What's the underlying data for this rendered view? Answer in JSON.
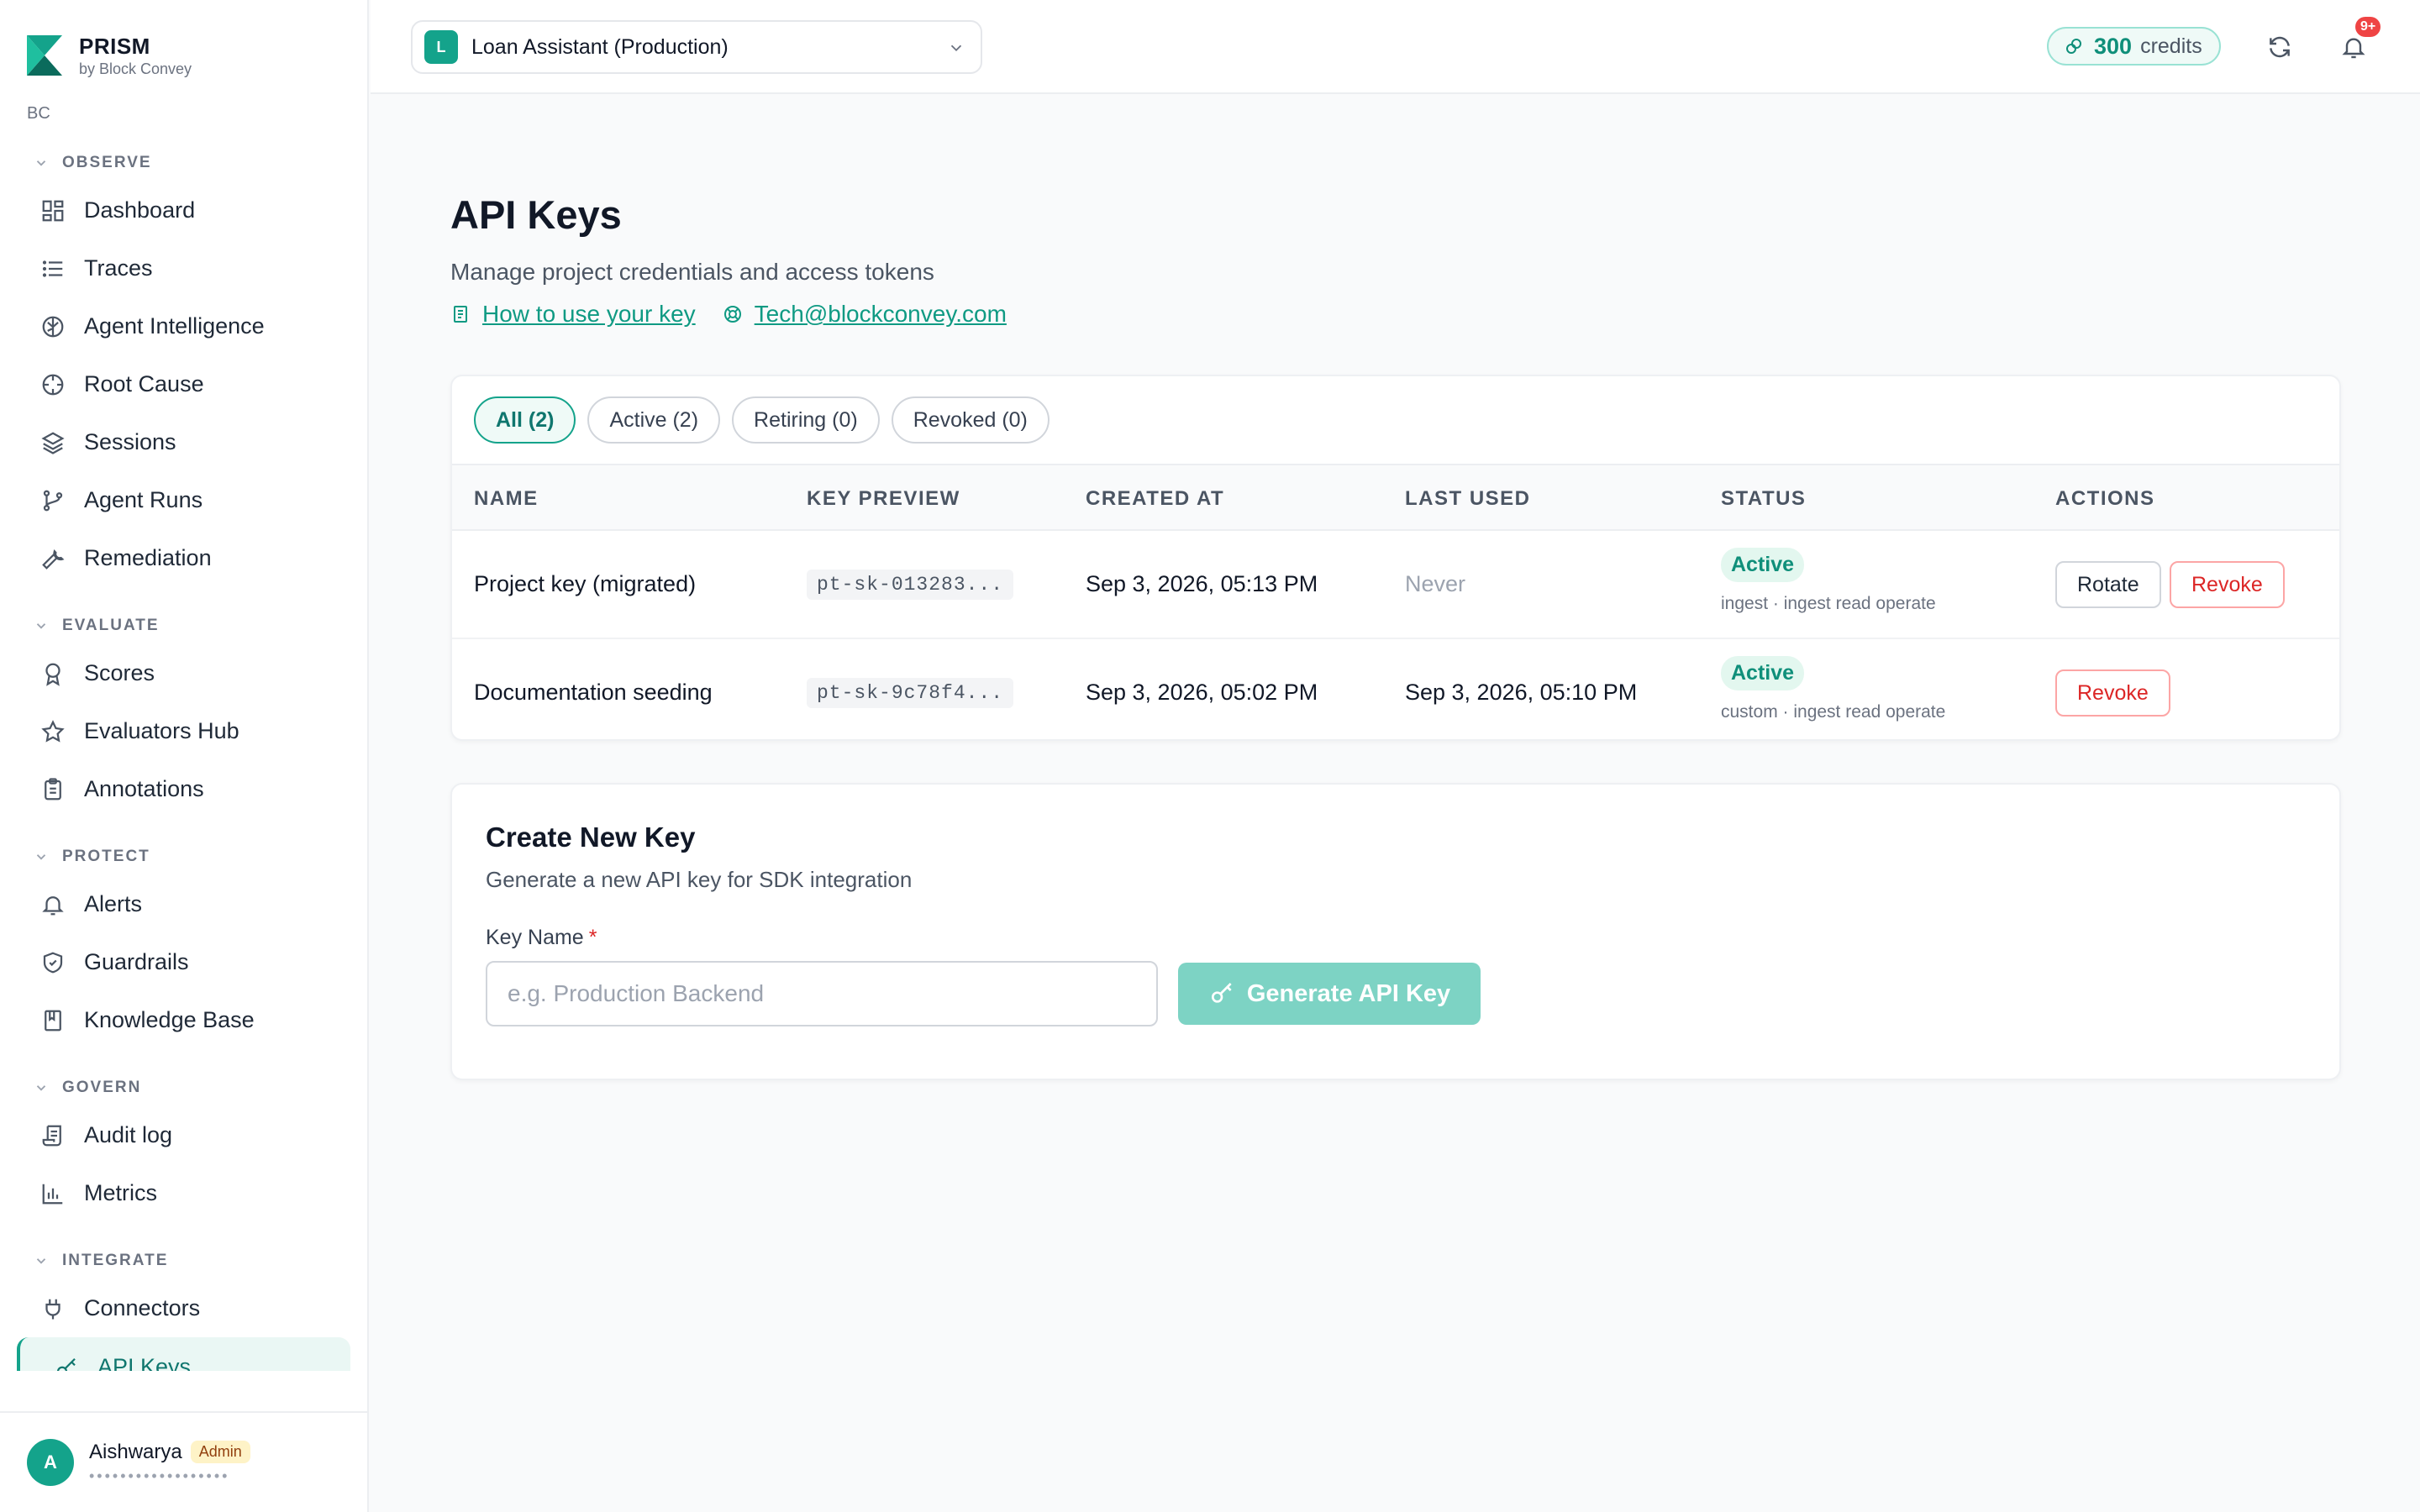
{
  "brand": {
    "name": "PRISM",
    "sub": "by Block Convey",
    "org": "BC"
  },
  "sidebar": {
    "sections": [
      {
        "title": "OBSERVE",
        "items": [
          {
            "label": "Dashboard",
            "icon": "dashboard-icon"
          },
          {
            "label": "Traces",
            "icon": "list-icon"
          },
          {
            "label": "Agent Intelligence",
            "icon": "brain-icon"
          },
          {
            "label": "Root Cause",
            "icon": "crosshair-icon"
          },
          {
            "label": "Sessions",
            "icon": "layers-icon"
          },
          {
            "label": "Agent Runs",
            "icon": "git-branch-icon"
          },
          {
            "label": "Remediation",
            "icon": "wrench-icon"
          }
        ]
      },
      {
        "title": "EVALUATE",
        "items": [
          {
            "label": "Scores",
            "icon": "award-icon"
          },
          {
            "label": "Evaluators Hub",
            "icon": "star-icon"
          },
          {
            "label": "Annotations",
            "icon": "clipboard-icon"
          }
        ]
      },
      {
        "title": "PROTECT",
        "items": [
          {
            "label": "Alerts",
            "icon": "bell-icon"
          },
          {
            "label": "Guardrails",
            "icon": "shield-icon"
          },
          {
            "label": "Knowledge Base",
            "icon": "book-icon"
          }
        ]
      },
      {
        "title": "GOVERN",
        "items": [
          {
            "label": "Audit log",
            "icon": "scroll-icon"
          },
          {
            "label": "Metrics",
            "icon": "bar-chart-icon"
          }
        ]
      },
      {
        "title": "INTEGRATE",
        "items": [
          {
            "label": "Connectors",
            "icon": "plug-icon"
          },
          {
            "label": "API Keys",
            "icon": "key-icon",
            "active": true
          }
        ]
      }
    ]
  },
  "user": {
    "initial": "A",
    "name": "Aishwarya",
    "role": "Admin",
    "email_masked": "••••••••••••••••••"
  },
  "topbar": {
    "project_initial": "L",
    "project_name": "Loan Assistant (Production)",
    "credits_value": "300",
    "credits_unit": "credits",
    "notification_count": "9+"
  },
  "page": {
    "title": "API Keys",
    "subtitle": "Manage project credentials and access tokens",
    "link_docs": "How to use your key",
    "link_email": "Tech@blockconvey.com"
  },
  "filters": [
    "All (2)",
    "Active (2)",
    "Retiring (0)",
    "Revoked (0)"
  ],
  "table": {
    "headers": [
      "NAME",
      "KEY PREVIEW",
      "CREATED AT",
      "LAST USED",
      "STATUS",
      "ACTIONS"
    ],
    "rows": [
      {
        "name": "Project key (migrated)",
        "key_preview": "pt-sk-013283...",
        "created_at": "Sep 3, 2026, 05:13 PM",
        "last_used": "Never",
        "status": "Active",
        "scopes": "ingest · ingest read operate",
        "rotate": "Rotate",
        "revoke": "Revoke"
      },
      {
        "name": "Documentation seeding",
        "key_preview": "pt-sk-9c78f4...",
        "created_at": "Sep 3, 2026, 05:02 PM",
        "last_used": "Sep 3, 2026, 05:10 PM",
        "status": "Active",
        "scopes": "custom · ingest read operate",
        "revoke": "Revoke"
      }
    ]
  },
  "create": {
    "title": "Create New Key",
    "subtitle": "Generate a new API key for SDK integration",
    "field_label": "Key Name",
    "required_mark": "*",
    "placeholder": "e.g. Production Backend",
    "button": "Generate API Key"
  },
  "colors": {
    "accent": "#14a38b",
    "danger": "#dc2626",
    "button_disabled": "#7dd3c4"
  }
}
